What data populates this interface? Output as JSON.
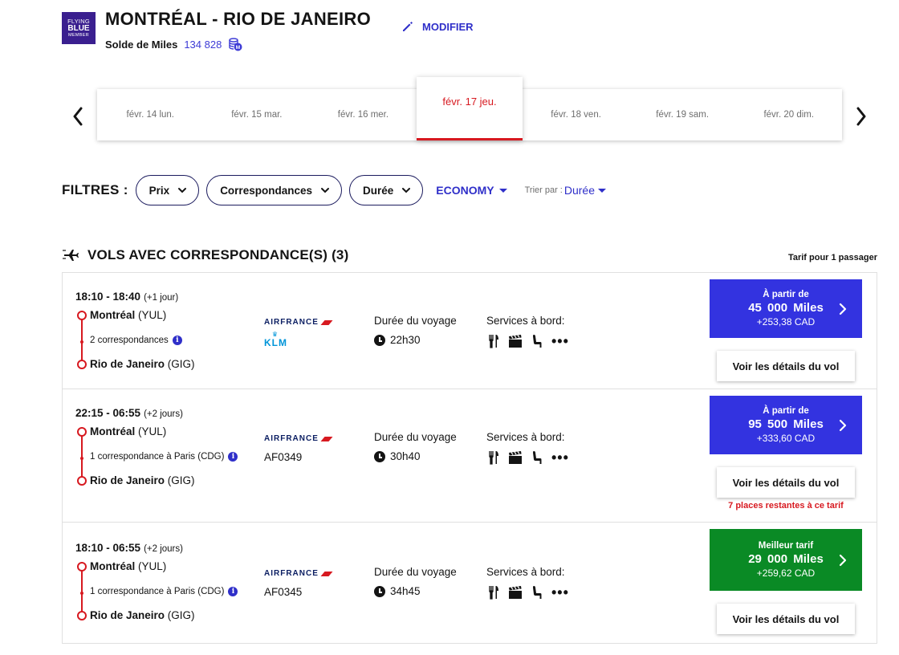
{
  "header": {
    "logo": {
      "line1": "FLYING",
      "line2": "BLUE",
      "line3": "MEMBER"
    },
    "route_title": "MONTRÉAL - RIO DE JANEIRO",
    "miles_label": "Solde de Miles",
    "miles_value": "134 828",
    "modify_label": "MODIFIER"
  },
  "dates": [
    {
      "label": "févr. 14 lun.",
      "active": false
    },
    {
      "label": "févr. 15 mar.",
      "active": false
    },
    {
      "label": "févr. 16 mer.",
      "active": false
    },
    {
      "label": "févr. 17 jeu.",
      "active": true
    },
    {
      "label": "févr. 18 ven.",
      "active": false
    },
    {
      "label": "févr. 19 sam.",
      "active": false
    },
    {
      "label": "févr. 20 dim.",
      "active": false
    }
  ],
  "filters": {
    "label": "FILTRES :",
    "pills": [
      "Prix",
      "Correspondances",
      "Durée"
    ],
    "cabin": "ECONOMY",
    "sort_label": "Trier par :",
    "sort_value": "Durée"
  },
  "section": {
    "title": "VOLS AVEC CORRESPONDANCE(S) (3)",
    "fare_note": "Tarif pour 1 passager"
  },
  "labels": {
    "duration": "Durée du voyage",
    "services": "Services à bord:",
    "details_button": "Voir les détails du vol",
    "miles_unit": "Miles"
  },
  "flights": [
    {
      "times": "18:10 - 18:40",
      "day_offset": "(+1 jour)",
      "origin_city": "Montréal",
      "origin_code": "(YUL)",
      "connection": "2 correspondances",
      "dest_city": "Rio de Janeiro",
      "dest_code": "(GIG)",
      "airline": "AIRFRANCE",
      "partner": "KLM",
      "flight_number": "",
      "duration": "22h30",
      "price_heading": "À partir de",
      "miles": "45 000",
      "cad": "+253,38 CAD",
      "seats_left": ""
    },
    {
      "times": "22:15 - 06:55",
      "day_offset": "(+2 jours)",
      "origin_city": "Montréal",
      "origin_code": "(YUL)",
      "connection": "1 correspondance à Paris (CDG)",
      "dest_city": "Rio de Janeiro",
      "dest_code": "(GIG)",
      "airline": "AIRFRANCE",
      "partner": "",
      "flight_number": "AF0349",
      "duration": "30h40",
      "price_heading": "À partir de",
      "miles": "95 500",
      "cad": "+333,60 CAD",
      "seats_left": "7 places restantes à ce tarif"
    },
    {
      "times": "18:10 - 06:55",
      "day_offset": "(+2 jours)",
      "origin_city": "Montréal",
      "origin_code": "(YUL)",
      "connection": "1 correspondance à Paris (CDG)",
      "dest_city": "Rio de Janeiro",
      "dest_code": "(GIG)",
      "airline": "AIRFRANCE",
      "partner": "",
      "flight_number": "AF0345",
      "duration": "34h45",
      "price_heading": "Meilleur tarif",
      "miles": "29 000",
      "cad": "+259,62 CAD",
      "seats_left": ""
    }
  ],
  "colors": {
    "brand_blue": "#3333e0",
    "link_blue": "#2f2fc9",
    "best_green": "#0a8a25",
    "accent_red": "#d71920",
    "logo_purple": "#3a1f8f"
  }
}
